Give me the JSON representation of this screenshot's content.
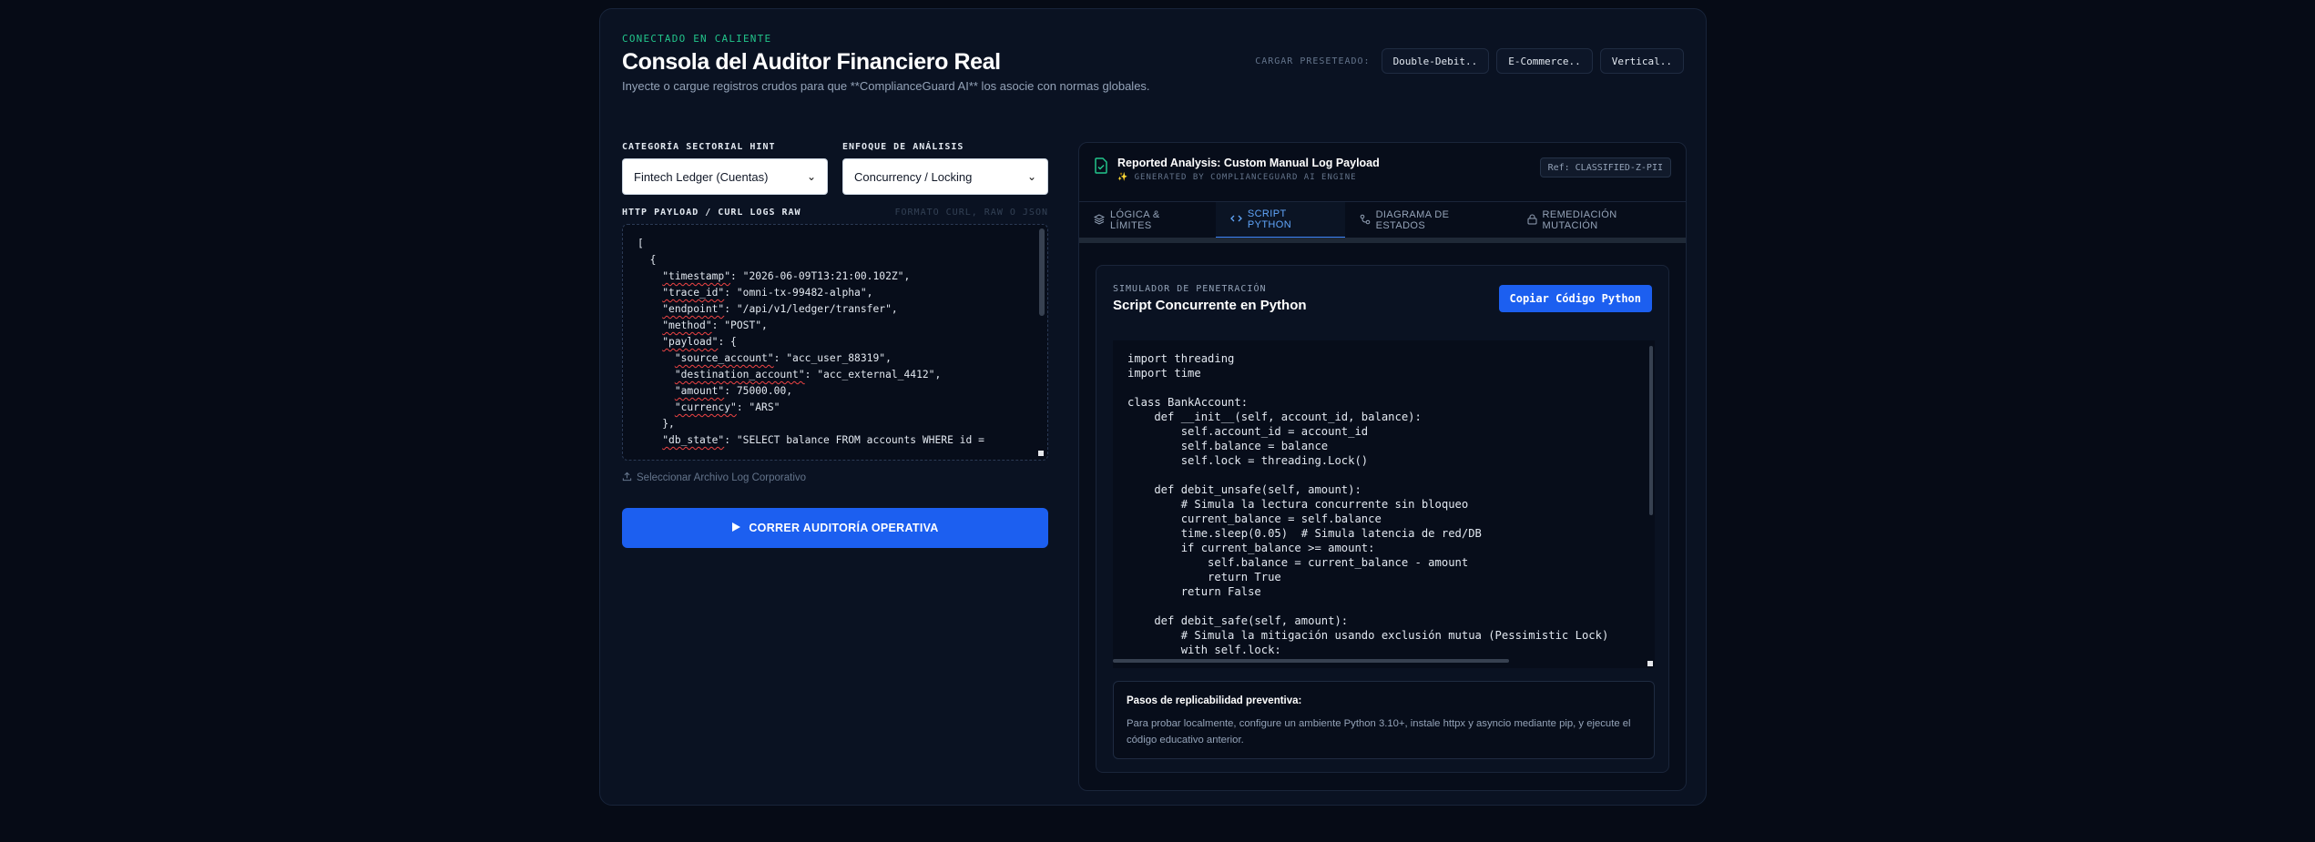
{
  "header": {
    "status": "CONECTADO EN CALIENTE",
    "title": "Consola del Auditor Financiero Real",
    "subtitle": "Inyecte o cargue registros crudos para que **ComplianceGuard AI** los asocie con normas globales.",
    "presets_label": "CARGAR PRESETEADO:",
    "presets": [
      "Double-Debit..",
      "E-Commerce..",
      "Vertical.."
    ]
  },
  "left": {
    "sector_label": "CATEGORÍA SECTORIAL HINT",
    "sector_value": "Fintech Ledger (Cuentas)",
    "focus_label": "ENFOQUE DE ANÁLISIS",
    "focus_value": "Concurrency / Locking",
    "payload_label": "HTTP PAYLOAD / CURL LOGS RAW",
    "payload_hint": "FORMATO CURL, RAW O JSON",
    "upload_label": "Seleccionar Archivo Log Corporativo",
    "run_label": "CORRER AUDITORÍA OPERATIVA",
    "payload": {
      "l0": "[",
      "l1": "  {",
      "l2k": "\"timestamp\"",
      "l2v": ": \"2026-06-09T13:21:00.102Z\",",
      "l3k": "\"trace_id\"",
      "l3v": ": \"omni-tx-99482-alpha\",",
      "l4k": "\"endpoint\"",
      "l4v": ": \"/api/v1/ledger/transfer\",",
      "l5k": "\"method\"",
      "l5v": ": \"POST\",",
      "l6k": "\"payload\"",
      "l6v": ": {",
      "l7k": "\"source_account\"",
      "l7v": ": \"acc_user_88319\",",
      "l8k": "\"destination_account\"",
      "l8v": ": \"acc_external_4412\",",
      "l9k": "\"amount\"",
      "l9v": ": 75000.00,",
      "l10k": "\"currency\"",
      "l10v": ": \"ARS\"",
      "l11": "    },",
      "l12k": "\"db_state\"",
      "l12v": ": \"SELECT balance FROM accounts WHERE id ="
    }
  },
  "panel": {
    "title": "Reported Analysis: Custom Manual Log Payload",
    "subtitle": "GENERATED BY COMPLIANCEGUARD AI ENGINE",
    "ref": "Ref: CLASSIFIED-Z-PII",
    "tabs": [
      "LÓGICA & LÍMITES",
      "SCRIPT PYTHON",
      "DIAGRAMA DE ESTADOS",
      "REMEDIACIÓN MUTACIÓN"
    ],
    "sim_kicker": "SIMULADOR DE PENETRACIÓN",
    "sim_title": "Script Concurrente en Python",
    "copy_label": "Copiar Código Python",
    "code": "import threading\nimport time\n\nclass BankAccount:\n    def __init__(self, account_id, balance):\n        self.account_id = account_id\n        self.balance = balance\n        self.lock = threading.Lock()\n\n    def debit_unsafe(self, amount):\n        # Simula la lectura concurrente sin bloqueo\n        current_balance = self.balance\n        time.sleep(0.05)  # Simula latencia de red/DB\n        if current_balance >= amount:\n            self.balance = current_balance - amount\n            return True\n        return False\n\n    def debit_safe(self, amount):\n        # Simula la mitigación usando exclusión mutua (Pessimistic Lock)\n        with self.lock:",
    "steps_title": "Pasos de replicabilidad preventiva:",
    "steps_body": "Para probar localmente, configure un ambiente Python 3.10+, instale httpx y asyncio mediante pip, y ejecute el código educativo anterior."
  },
  "colors": {
    "accent": "#1c5ff0",
    "status": "#22c58b",
    "tab_active": "#60a5fa"
  }
}
